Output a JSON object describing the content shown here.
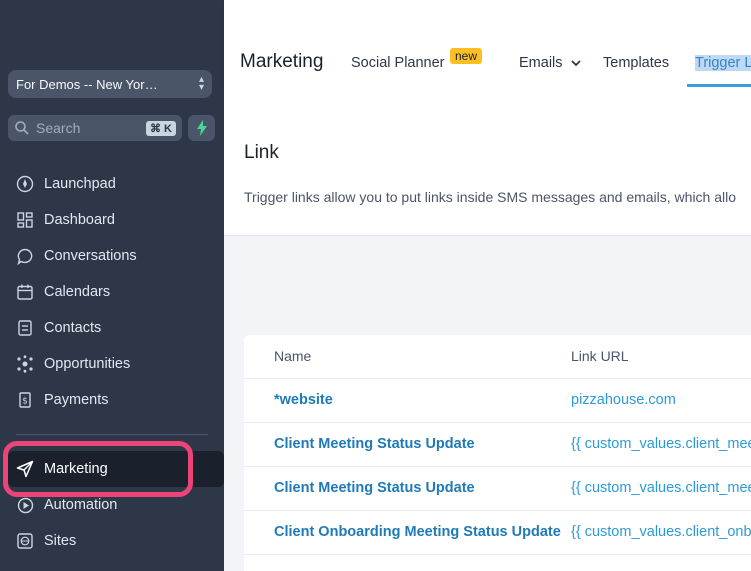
{
  "sidebar": {
    "account_name": "For Demos -- New Yor…",
    "search_placeholder": "Search",
    "search_shortcut": "⌘ K",
    "items": [
      {
        "label": "Launchpad",
        "icon": "rocket-icon"
      },
      {
        "label": "Dashboard",
        "icon": "grid-icon"
      },
      {
        "label": "Conversations",
        "icon": "chat-icon"
      },
      {
        "label": "Calendars",
        "icon": "calendar-icon"
      },
      {
        "label": "Contacts",
        "icon": "contacts-icon"
      },
      {
        "label": "Opportunities",
        "icon": "opportunities-icon"
      },
      {
        "label": "Payments",
        "icon": "payments-icon"
      },
      {
        "label": "Marketing",
        "icon": "send-icon",
        "active": true
      },
      {
        "label": "Automation",
        "icon": "automation-icon"
      },
      {
        "label": "Sites",
        "icon": "globe-icon"
      }
    ]
  },
  "header": {
    "title": "Marketing",
    "tabs": [
      {
        "label": "Social Planner",
        "badge": "new"
      },
      {
        "label": "Emails",
        "dropdown": true
      },
      {
        "label": "Templates"
      },
      {
        "label": "Trigger L",
        "active": true
      }
    ]
  },
  "link_section": {
    "title": "Link",
    "description": "Trigger links allow you to put links inside SMS messages and emails, which allo"
  },
  "table": {
    "columns": [
      "Name",
      "Link URL"
    ],
    "rows": [
      {
        "name": "*website",
        "url": "pizzahouse.com"
      },
      {
        "name": "Client Meeting Status Update",
        "url": "{{ custom_values.client_mee"
      },
      {
        "name": "Client Meeting Status Update",
        "url": "{{ custom_values.client_mee"
      },
      {
        "name": "Client Onboarding Meeting Status Update",
        "url": "{{ custom_values.client_onb"
      }
    ]
  },
  "colors": {
    "sidebar_bg": "#2d3748",
    "highlight": "#ec4477",
    "link_blue": "#1f7ab8",
    "badge_yellow": "#fbbf24"
  }
}
